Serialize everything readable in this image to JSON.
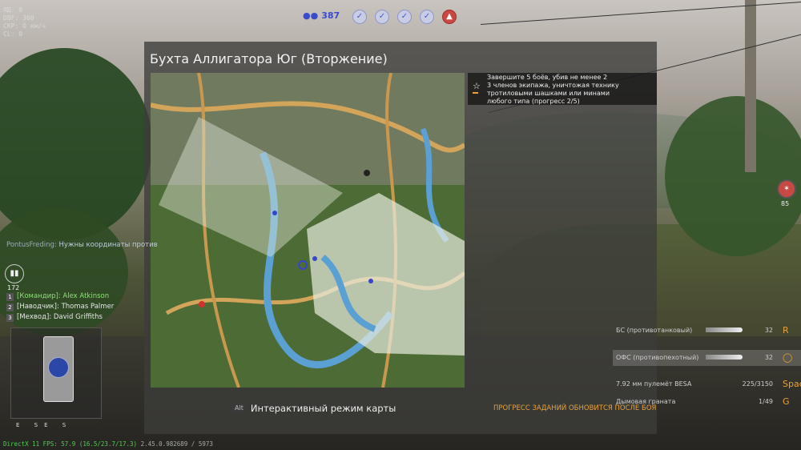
{
  "hud_debug": [
    "ЯД: 0",
    "DBF: 300",
    "СКР: 0 км/ч",
    "CL: 0"
  ],
  "top": {
    "players_count": "387",
    "objectives": [
      {
        "icon": "check-icon",
        "state": "captured"
      },
      {
        "icon": "check-icon",
        "state": "captured"
      },
      {
        "icon": "check-icon",
        "state": "captured"
      },
      {
        "icon": "check-icon",
        "state": "captured"
      },
      {
        "icon": "enemy-icon",
        "state": "enemy"
      }
    ]
  },
  "map_panel": {
    "title": "Бухта Аллигатора Юг (Вторжение)",
    "mission": {
      "lines": [
        "Завершите 5 боёв, убив не менее 2",
        "3 членов экипажа, уничтожая технику",
        "тротиловыми шашками или минами",
        "любого типа (прогресс 2/5)"
      ],
      "progress": 0.4
    },
    "footer_key": "Alt",
    "footer_label": "Интерактивный режим карты",
    "progress_note": "ПРОГРЕСС ЗАДАНИЙ ОБНОВИТСЯ ПОСЛЕ БОЯ"
  },
  "chat": {
    "name": "PontusFreding:",
    "message": "Нужны координаты против"
  },
  "ammo": {
    "count": "172"
  },
  "crew": [
    {
      "num": "1",
      "role": "[Командир]:",
      "name": "Alex Atkinson",
      "active": true
    },
    {
      "num": "2",
      "role": "[Наводчик]:",
      "name": "Thomas Palmer",
      "active": false
    },
    {
      "num": "3",
      "role": "[Мехвод]:",
      "name": "David Griffiths",
      "active": false
    }
  ],
  "compass": [
    "E",
    "SE",
    "S"
  ],
  "fps_line": "DirectX 11 FPS: 57.9 (16.5/23.7/17.3)",
  "build_line": "2.45.0.982689 / 5973",
  "weapons": [
    {
      "name": "БС (противотанковый)",
      "count": "32",
      "bind": "R",
      "selected": false
    },
    {
      "name": "ОФС (противопехотный)",
      "count": "32",
      "bind": "",
      "selected": true
    },
    {
      "name": "7.92 мм пулемёт BESA",
      "count": "225/3150",
      "bind": "Space",
      "selected": false
    },
    {
      "name": "Дымовая граната",
      "count": "1/49",
      "bind": "G",
      "selected": false
    }
  ],
  "right_indicator": "85",
  "colors": {
    "accent_orange": "#e8a33a",
    "team_blue": "#3a4bd0",
    "enemy_red": "#c84944",
    "crew_active": "#8fe07a"
  }
}
